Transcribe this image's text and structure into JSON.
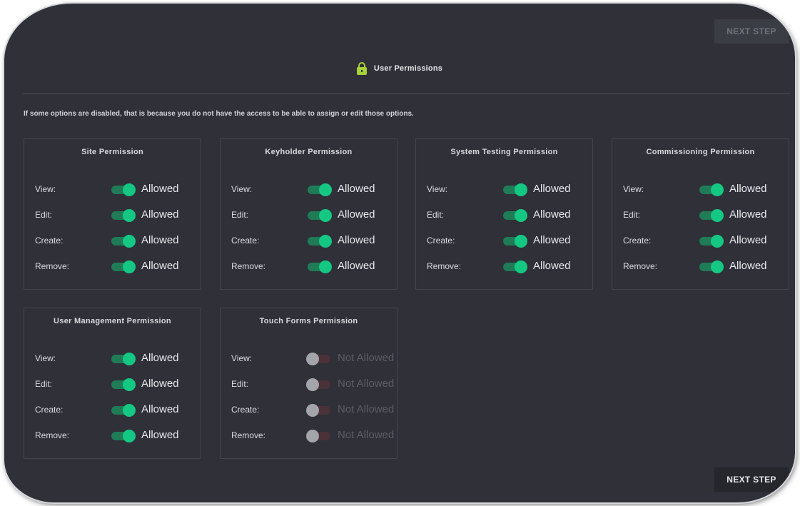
{
  "buttons": {
    "next_step_top": "NEXT STEP",
    "next_step_bottom": "NEXT STEP"
  },
  "header": {
    "title": "User Permissions",
    "icon": "lock-icon",
    "icon_color": "#a7d03a"
  },
  "notice": "If some options are disabled, that is because you do not have the access to be able to assign or edit those options.",
  "colors": {
    "toggle_on": "#14c883",
    "toggle_off": "#a4a5aa",
    "background": "#2f3038"
  },
  "cards": [
    {
      "title": "Site Permission",
      "rows": [
        {
          "label": "View:",
          "status": "Allowed",
          "on": true
        },
        {
          "label": "Edit:",
          "status": "Allowed",
          "on": true
        },
        {
          "label": "Create:",
          "status": "Allowed",
          "on": true
        },
        {
          "label": "Remove:",
          "status": "Allowed",
          "on": true
        }
      ]
    },
    {
      "title": "Keyholder Permission",
      "rows": [
        {
          "label": "View:",
          "status": "Allowed",
          "on": true
        },
        {
          "label": "Edit:",
          "status": "Allowed",
          "on": true
        },
        {
          "label": "Create:",
          "status": "Allowed",
          "on": true
        },
        {
          "label": "Remove:",
          "status": "Allowed",
          "on": true
        }
      ]
    },
    {
      "title": "System Testing Permission",
      "rows": [
        {
          "label": "View:",
          "status": "Allowed",
          "on": true
        },
        {
          "label": "Edit:",
          "status": "Allowed",
          "on": true
        },
        {
          "label": "Create:",
          "status": "Allowed",
          "on": true
        },
        {
          "label": "Remove:",
          "status": "Allowed",
          "on": true
        }
      ]
    },
    {
      "title": "Commissioning Permission",
      "rows": [
        {
          "label": "View:",
          "status": "Allowed",
          "on": true
        },
        {
          "label": "Edit:",
          "status": "Allowed",
          "on": true
        },
        {
          "label": "Create:",
          "status": "Allowed",
          "on": true
        },
        {
          "label": "Remove:",
          "status": "Allowed",
          "on": true
        }
      ]
    },
    {
      "title": "User Management Permission",
      "rows": [
        {
          "label": "View:",
          "status": "Allowed",
          "on": true
        },
        {
          "label": "Edit:",
          "status": "Allowed",
          "on": true
        },
        {
          "label": "Create:",
          "status": "Allowed",
          "on": true
        },
        {
          "label": "Remove:",
          "status": "Allowed",
          "on": true
        }
      ]
    },
    {
      "title": "Touch Forms Permission",
      "rows": [
        {
          "label": "View:",
          "status": "Not Allowed",
          "on": false
        },
        {
          "label": "Edit:",
          "status": "Not Allowed",
          "on": false
        },
        {
          "label": "Create:",
          "status": "Not Allowed",
          "on": false
        },
        {
          "label": "Remove:",
          "status": "Not Allowed",
          "on": false
        }
      ]
    }
  ]
}
